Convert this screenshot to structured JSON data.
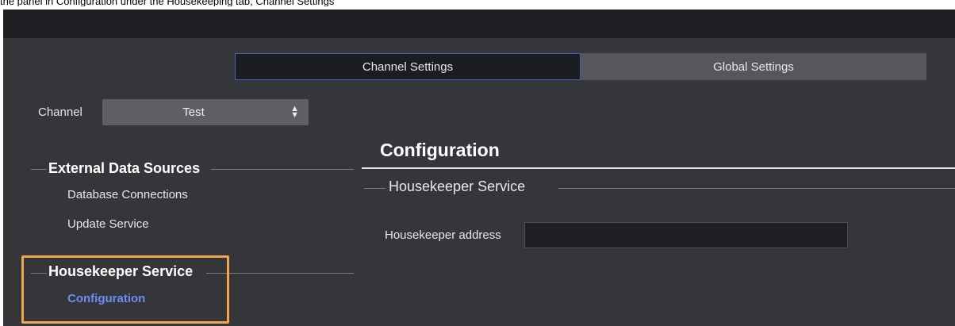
{
  "caption": "the panel in Configuration under the Housekeeping tab, Channel Settings",
  "tabs": {
    "channel_settings": "Channel Settings",
    "global_settings": "Global Settings"
  },
  "channel": {
    "label": "Channel",
    "value": "Test"
  },
  "sidebar": {
    "external_data_sources": {
      "title": "External Data Sources",
      "items": [
        "Database Connections",
        "Update Service"
      ]
    },
    "housekeeper_service": {
      "title": "Housekeeper Service",
      "items": [
        "Configuration"
      ]
    }
  },
  "main": {
    "title": "Configuration",
    "group_title": "Housekeeper Service",
    "fields": {
      "housekeeper_address_label": "Housekeeper address",
      "housekeeper_address_value": ""
    }
  },
  "colors": {
    "background": "#34363a",
    "accent": "#6f8cf5",
    "highlight": "#f2a64a"
  }
}
